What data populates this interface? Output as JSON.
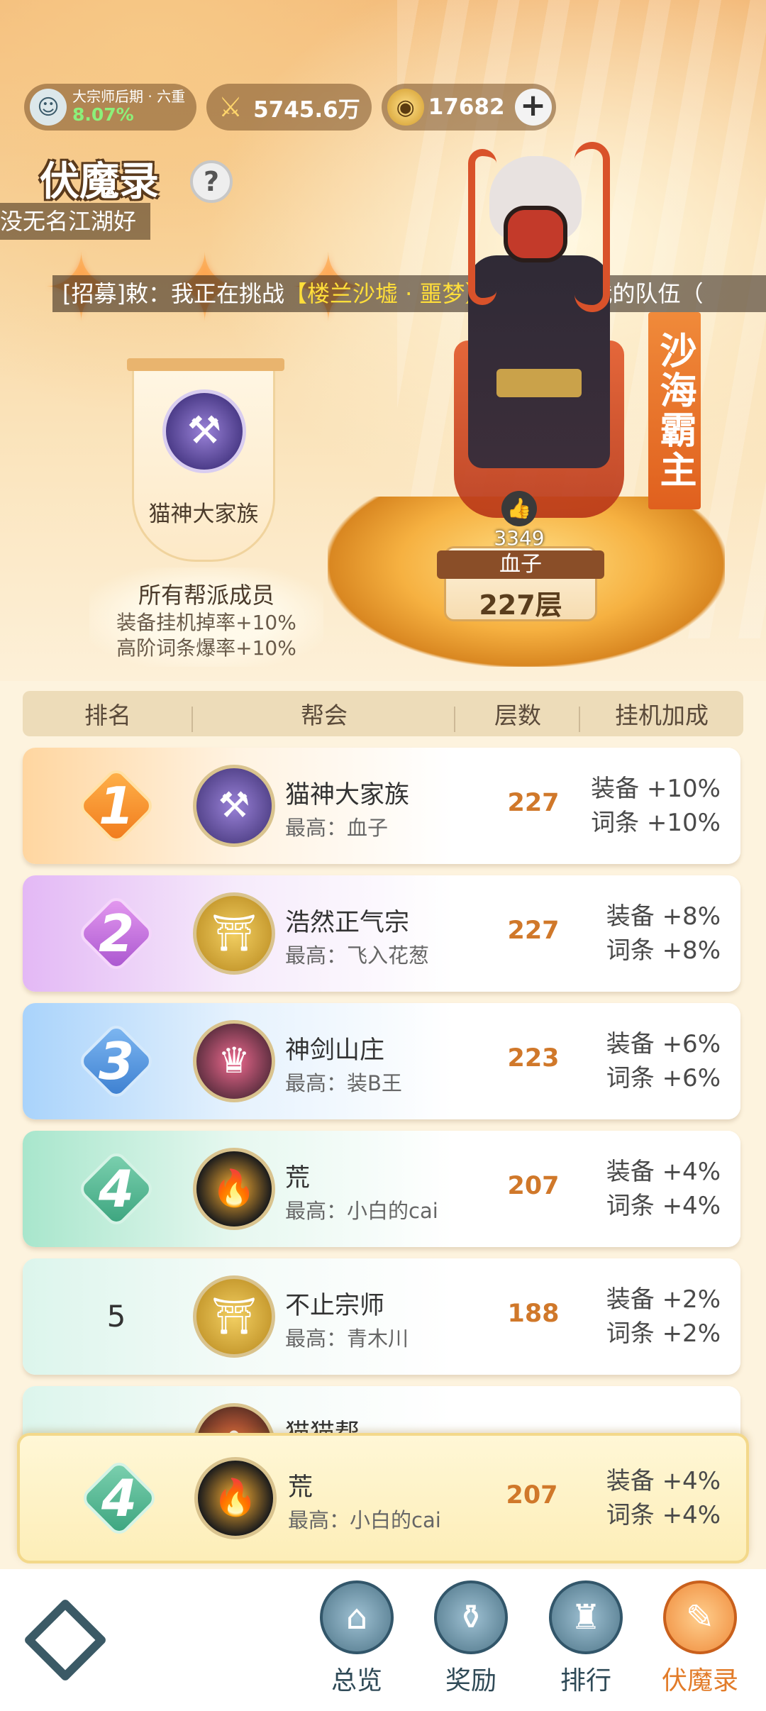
{
  "status": {
    "realm_name": "大宗师后期 · 六重",
    "realm_progress": "8.07%",
    "power": "5745.6万",
    "coins": "17682"
  },
  "page_title": "伏魔录",
  "help_label": "?",
  "chat_top": "没无名江湖好",
  "chat_recruit": {
    "prefix": "[招募]敕：我正在挑战",
    "highlight": "【楼兰沙墟 · 噩梦】",
    "suffix": "，快来加入我的队伍（"
  },
  "leader": {
    "guild_name": "猫神大家族",
    "members_title": "所有帮派成员",
    "buff_lines": [
      "装备挂机掉率+10%",
      "高阶词条爆率+10%"
    ],
    "title": "沙海霸主",
    "likes": "3349",
    "player": "血子",
    "floor": "227层"
  },
  "table": {
    "headers": [
      "排名",
      "帮会",
      "层数",
      "挂机加成"
    ],
    "rows": [
      {
        "rank": "1",
        "name": "猫神大家族",
        "top": "最高：血子",
        "floor": "227",
        "equip": "装备 +10%",
        "affix": "词条 +10%"
      },
      {
        "rank": "2",
        "name": "浩然正气宗",
        "top": "最高：飞入花葱",
        "floor": "227",
        "equip": "装备 +8%",
        "affix": "词条 +8%"
      },
      {
        "rank": "3",
        "name": "神剑山庄",
        "top": "最高：装B王",
        "floor": "223",
        "equip": "装备 +6%",
        "affix": "词条 +6%"
      },
      {
        "rank": "4",
        "name": "荒",
        "top": "最高：小白的cai",
        "floor": "207",
        "equip": "装备 +4%",
        "affix": "词条 +4%"
      },
      {
        "rank": "5",
        "name": "不止宗师",
        "top": "最高：青木川",
        "floor": "188",
        "equip": "装备 +2%",
        "affix": "词条 +2%"
      },
      {
        "rank": "",
        "name": "猫猫帮",
        "top": "",
        "floor": "",
        "equip": "",
        "affix": ""
      }
    ]
  },
  "my_guild": {
    "rank": "4",
    "name": "荒",
    "top": "最高：小白的cai",
    "floor": "207",
    "equip": "装备 +4%",
    "affix": "词条 +4%"
  },
  "nav": [
    {
      "label": "总览",
      "icon": "overview-icon"
    },
    {
      "label": "奖励",
      "icon": "reward-icon"
    },
    {
      "label": "排行",
      "icon": "ranking-icon"
    },
    {
      "label": "伏魔录",
      "icon": "scroll-icon"
    }
  ],
  "colors": {
    "accent": "#e27c2a",
    "floor_text": "#d0782a"
  }
}
